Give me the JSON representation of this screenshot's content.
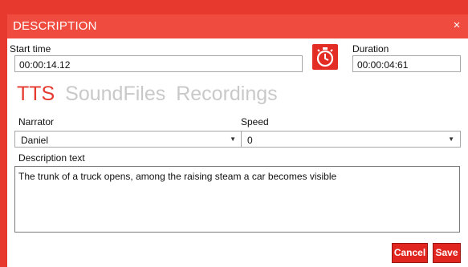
{
  "dialog": {
    "title": "DESCRIPTION",
    "close_glyph": "×"
  },
  "start_time": {
    "label": "Start time",
    "value": "00:00:14.12"
  },
  "timer_button": {
    "icon": "stopwatch-icon"
  },
  "duration": {
    "label": "Duration",
    "value": "00:00:04:61"
  },
  "tabs": [
    {
      "label": "TTS",
      "active": true
    },
    {
      "label": "SoundFiles",
      "active": false
    },
    {
      "label": "Recordings",
      "active": false
    }
  ],
  "narrator": {
    "label": "Narrator",
    "value": "Daniel"
  },
  "speed": {
    "label": "Speed",
    "value": "0"
  },
  "description": {
    "label": "Description text",
    "value": "The trunk of a truck opens, among the raising steam a car becomes visible"
  },
  "buttons": {
    "cancel": "Cancel",
    "save": "Save"
  },
  "colors": {
    "accent": "#e8392e",
    "titlebar": "#ef4b3f",
    "inactive_tab": "#c9c9c9"
  }
}
